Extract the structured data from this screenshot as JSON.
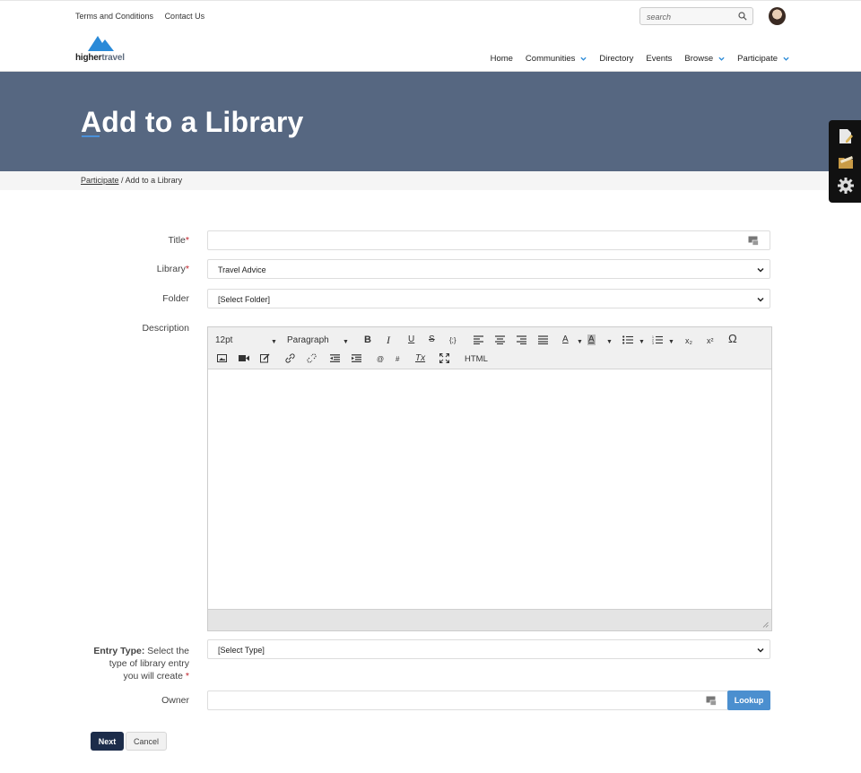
{
  "header": {
    "util_links": [
      "Terms and Conditions",
      "Contact Us"
    ],
    "search_placeholder": "search",
    "logo_brand_bold": "higher",
    "logo_brand_light": "travel",
    "nav": [
      {
        "label": "Home",
        "dropdown": false
      },
      {
        "label": "Communities",
        "dropdown": true
      },
      {
        "label": "Directory",
        "dropdown": false
      },
      {
        "label": "Events",
        "dropdown": false
      },
      {
        "label": "Browse",
        "dropdown": true
      },
      {
        "label": "Participate",
        "dropdown": true
      }
    ]
  },
  "banner": {
    "title": "Add to a Library"
  },
  "breadcrumb": {
    "parent": "Participate",
    "separator": "/",
    "current": "Add to a Library"
  },
  "form": {
    "title_label": "Title",
    "title_value": "",
    "library_label": "Library",
    "library_value": "Travel Advice",
    "folder_label": "Folder",
    "folder_value": "[Select Folder]",
    "description_label": "Description",
    "entry_type_label_bold": "Entry Type:",
    "entry_type_label_line1": "Select the",
    "entry_type_label_line2": "type of library entry",
    "entry_type_label_line3": "you will create",
    "entry_type_value": "[Select Type]",
    "owner_label": "Owner",
    "owner_value": "",
    "lookup_label": "Lookup",
    "required_mark": "*"
  },
  "editor": {
    "font_size": "12pt",
    "block_format": "Paragraph",
    "html_label": "HTML",
    "bold": "B",
    "italic": "I",
    "underline": "U",
    "strike": "S",
    "code": "{;}",
    "text_color": "A",
    "bg_color": "A",
    "subscript": "x₂",
    "superscript": "x²",
    "special_char": "Ω",
    "anchor": "@",
    "hash": "#",
    "clear_format": "Tx"
  },
  "actions": {
    "next": "Next",
    "cancel": "Cancel"
  },
  "colors": {
    "banner": "#566781",
    "next_button": "#1c2c4a",
    "lookup_button": "#4b8fcf",
    "required": "#c0222b"
  }
}
